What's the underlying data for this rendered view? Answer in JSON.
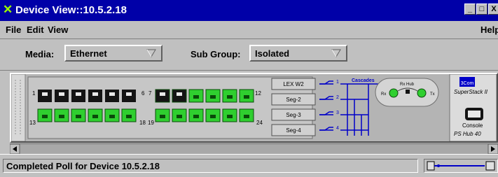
{
  "window": {
    "title": "Device View::10.5.2.18",
    "min_label": "_",
    "max_label": "□",
    "close_label": "X"
  },
  "menubar": {
    "file": "File",
    "edit": "Edit",
    "view": "View",
    "help": "Help"
  },
  "toolbar": {
    "media_label": "Media:",
    "media_value": "Ethernet",
    "subgroup_label": "Sub Group:",
    "subgroup_value": "Isolated"
  },
  "device": {
    "port_labels": {
      "p1": "1",
      "p6": "6",
      "p13": "13",
      "p18": "18",
      "p7": "7",
      "p12": "12",
      "p19": "19",
      "p24": "24"
    },
    "segments": [
      "LEX W2",
      "Seg-2",
      "Seg-3",
      "Seg-4"
    ],
    "segment_numbers": [
      "1",
      "2",
      "3",
      "4"
    ],
    "cascades_label": "Cascades",
    "rx_hub_label": "Rx Hub",
    "rx_label": "Rx",
    "tx_label": "Tx",
    "brand_logo": "3Com",
    "brand_product": "SuperStack II",
    "console_label": "Console",
    "hub_model": "PS Hub 40"
  },
  "status": {
    "message": "Completed Poll for Device 10.5.2.18"
  },
  "colors": {
    "titlebar": "#0000a8",
    "port_green": "#2fcf2f",
    "port_black": "#141414",
    "wire_blue": "#0000c8"
  }
}
